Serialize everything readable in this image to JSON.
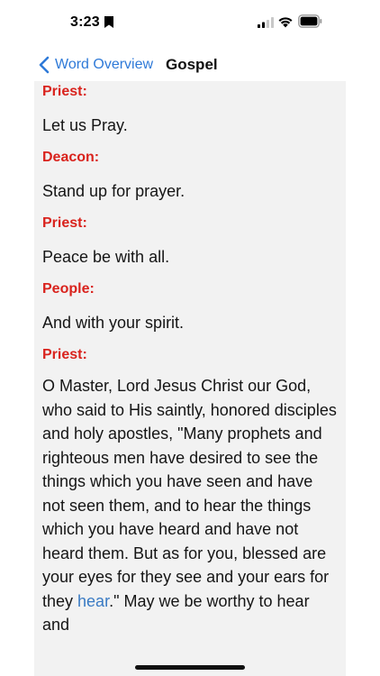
{
  "status_bar": {
    "time": "3:23",
    "icons": [
      "bookmark-icon",
      "signal-icon",
      "wifi-icon",
      "battery-icon"
    ]
  },
  "nav": {
    "back_label": "Word Overview",
    "title": "Gospel"
  },
  "colors": {
    "speaker": "#d9231d",
    "link": "#2f7ad8",
    "highlight": "#3a7bc4",
    "content_bg": "#f2f2f2"
  },
  "blocks": [
    {
      "speaker": "Priest:",
      "text": "Let us Pray."
    },
    {
      "speaker": "Deacon:",
      "text": "Stand up for prayer."
    },
    {
      "speaker": "Priest:",
      "text": "Peace be with all."
    },
    {
      "speaker": "People:",
      "text": "And with your spirit."
    },
    {
      "speaker": "Priest:",
      "text_part1": "O Master, Lord Jesus Christ our God, who said to His saintly, honored disciples and holy apostles, \"Many prophets and righteous men have desired to see the things which you have seen and have not seen them, and to hear the things which you have heard and have not heard them. But as for you, blessed are your eyes for they see and your ears for they ",
      "highlight": "hear",
      "text_part2": ".\" May we be worthy to hear and"
    }
  ]
}
